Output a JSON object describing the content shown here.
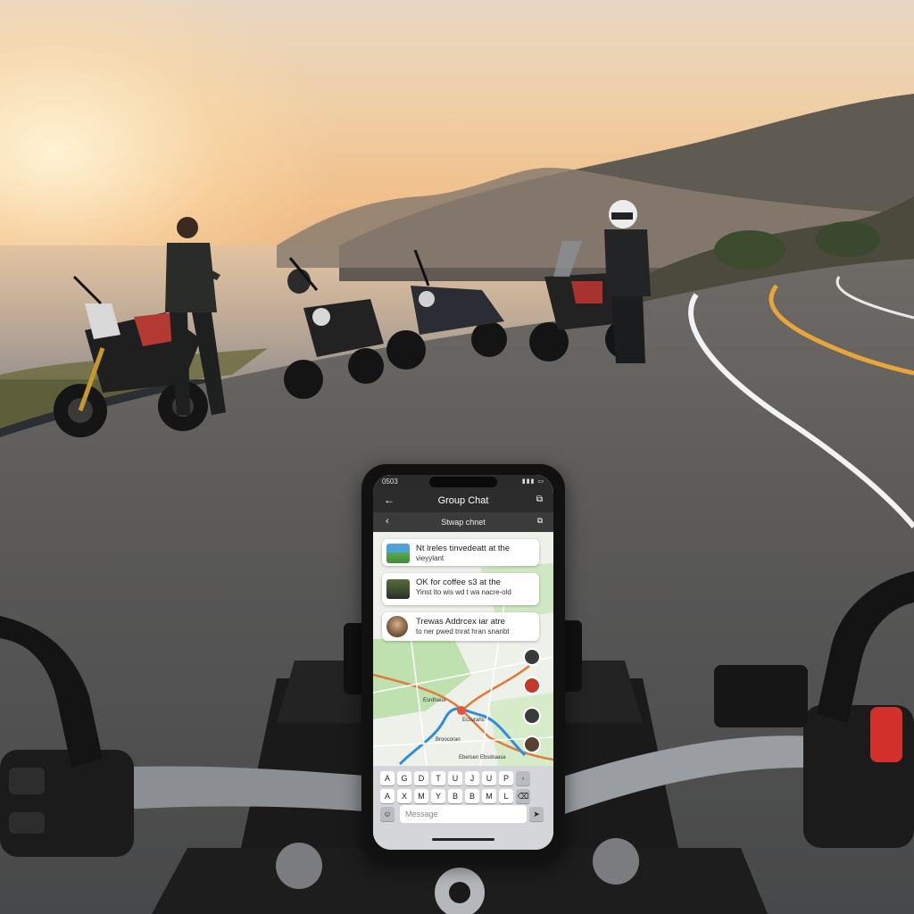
{
  "phone": {
    "status_time": "0503",
    "appbar_title": "Group Chat",
    "subbar_title": "Stwap chnet",
    "messages": [
      {
        "line1": "Nt lreles tinvedeatt at the",
        "line2": "vieyylant"
      },
      {
        "line1": "OK for coffee s3 at the",
        "line2": "Yinst ito wis wd t wa nacre-old"
      },
      {
        "line1": "Trewas Addrcex iar atre",
        "line2": "to ner pwed tnrat hran snanbt"
      }
    ],
    "map_labels": [
      "Esrdhaue",
      "Ecsvrahs",
      "Broocoran",
      "Ebersen Ebsdraase"
    ],
    "keyboard_row1": [
      "A",
      "G",
      "D",
      "T",
      "U",
      "J",
      "U",
      "P"
    ],
    "keyboard_row2": [
      "A",
      "X",
      "M",
      "Y",
      "B",
      "B",
      "M",
      "L"
    ],
    "message_placeholder": "Message"
  },
  "colors": {
    "map_green": "#bfe1b0",
    "route_blue": "#2f8be0",
    "route_orange": "#e07a3a",
    "road_center_line": "#e7a53a"
  }
}
